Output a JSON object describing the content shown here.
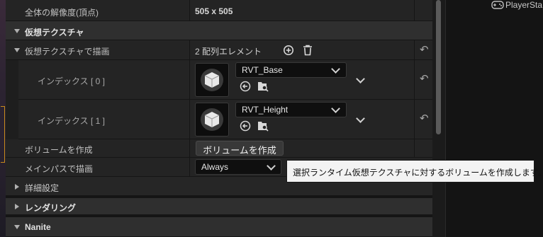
{
  "rows": {
    "resolution": {
      "label": "全体の解像度(頂点)",
      "value": "505 x 505"
    },
    "vt_category": {
      "label": "仮想テクスチャ"
    },
    "draw_in_vt": {
      "label": "仮想テクスチャで描画",
      "value": "2 配列エレメント"
    },
    "index0": {
      "label": "インデックス [ 0 ]",
      "asset": "RVT_Base"
    },
    "index1": {
      "label": "インデックス [ 1 ]",
      "asset": "RVT_Height"
    },
    "create_volume": {
      "label": "ボリュームを作成",
      "button": "ボリュームを作成"
    },
    "draw_main_pass": {
      "label": "メインパスで描画",
      "value": "Always"
    },
    "advanced": {
      "label": "詳細設定"
    },
    "rendering": {
      "label": "レンダリング"
    },
    "nanite": {
      "label": "Nanite"
    }
  },
  "tooltip": "選択ランタイム仮想テクスチャに対するボリュームを作成します。",
  "outliner": {
    "item": "PlayerSta"
  },
  "icons": {
    "add": "add-icon",
    "delete": "trash-icon",
    "reset": "reset-arrow-icon",
    "use": "use-selected-icon",
    "browse": "browse-icon",
    "gamepad": "gamepad-icon"
  },
  "colors": {
    "panel": "#242424",
    "category": "#2f2f2f",
    "tooltip_bg": "#f3f3f3",
    "highlight": "#c78b1a"
  }
}
